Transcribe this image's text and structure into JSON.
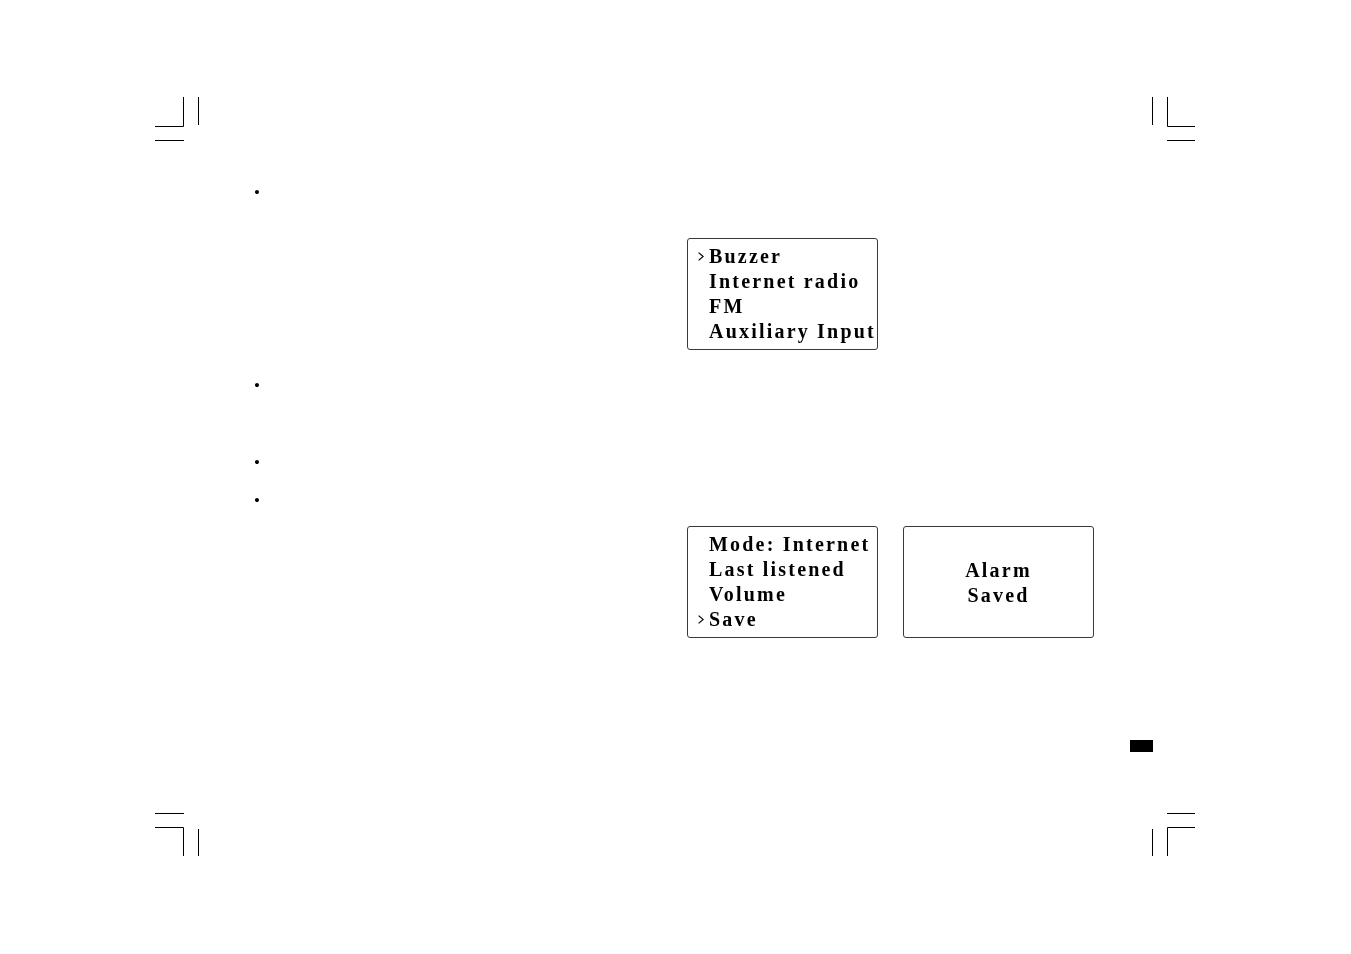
{
  "bullets": [
    "•",
    "•",
    "•",
    "•"
  ],
  "screens": [
    {
      "kind": "menu",
      "items": [
        {
          "label": "Buzzer",
          "selected": true
        },
        {
          "label": "Internet radio",
          "selected": false
        },
        {
          "label": "FM",
          "selected": false
        },
        {
          "label": "Auxiliary Input",
          "selected": false
        }
      ]
    },
    {
      "kind": "menu",
      "items": [
        {
          "label": "Mode: Internet",
          "selected": false
        },
        {
          "label": "Last listened",
          "selected": false
        },
        {
          "label": "Volume",
          "selected": false
        },
        {
          "label": "Save",
          "selected": true
        }
      ]
    },
    {
      "kind": "message",
      "lines": [
        "Alarm",
        "Saved"
      ]
    }
  ]
}
